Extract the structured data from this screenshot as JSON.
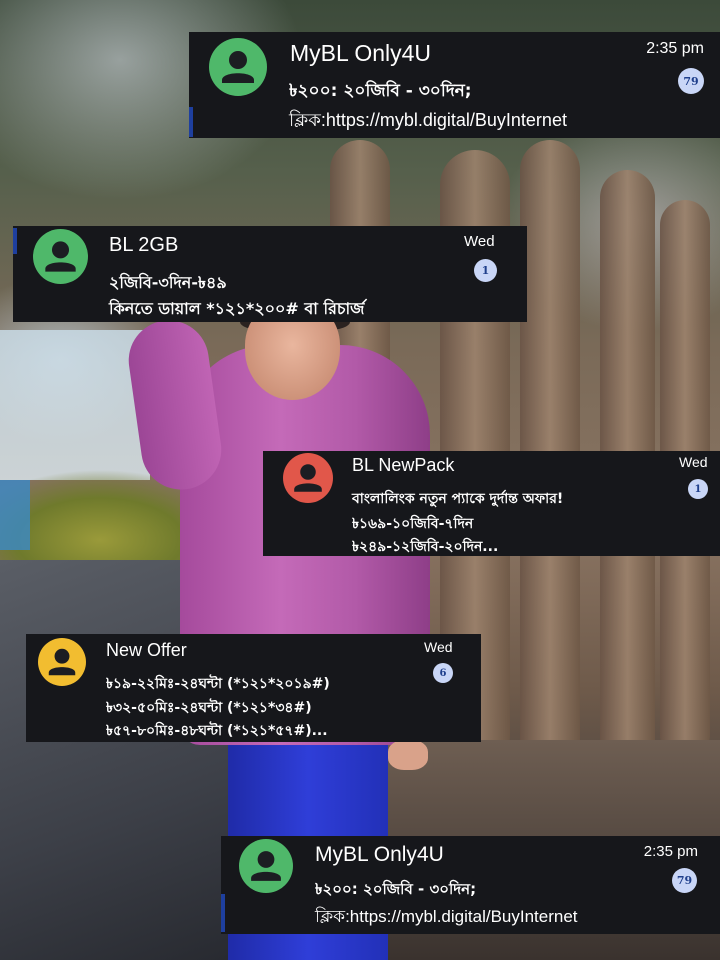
{
  "colors": {
    "card_bg": "#16171b",
    "text": "#ffffff",
    "badge_bg": "#c9d6f7",
    "badge_text": "#1f3f8c",
    "avatar_green": "#4fb86a",
    "avatar_red": "#e1574a",
    "avatar_yellow": "#f2bd30"
  },
  "notifications": [
    {
      "sender": "MyBL Only4U",
      "time": "2:35 pm",
      "lines": [
        "৳২০০: ২০জিবি - ৩০দিন;",
        "ক্লিক:https://mybl.digital/BuyInternet"
      ],
      "unread_count": "79",
      "avatar_icon": "person-icon",
      "avatar_color": "#4fb86a"
    },
    {
      "sender": "BL 2GB",
      "time": "Wed",
      "lines": [
        "২জিবি-৩দিন-৳৪৯",
        "কিনতে ডায়াল *১২১*২০০# বা রিচার্জ"
      ],
      "unread_count": "1",
      "avatar_icon": "person-icon",
      "avatar_color": "#4fb86a"
    },
    {
      "sender": "BL NewPack",
      "time": "Wed",
      "lines": [
        "বাংলালিংক নতুন প্যাকে দুর্দান্ত অফার!",
        "৳১৬৯-১০জিবি-৭দিন",
        "৳২৪৯-১২জিবি-২০দিন..."
      ],
      "unread_count": "1",
      "avatar_icon": "person-icon",
      "avatar_color": "#e1574a"
    },
    {
      "sender": "New Offer",
      "time": "Wed",
      "lines": [
        "৳১৯-২২মিঃ-২৪ঘন্টা (*১২১*২০১৯#)",
        "৳৩২-৫০মিঃ-২৪ঘন্টা (*১২১*৩৪#)",
        "৳৫৭-৮০মিঃ-৪৮ঘন্টা (*১২১*৫৭#)..."
      ],
      "unread_count": "6",
      "avatar_icon": "person-icon",
      "avatar_color": "#f2bd30"
    },
    {
      "sender": "MyBL Only4U",
      "time": "2:35 pm",
      "lines": [
        "৳২০০: ২০জিবি - ৩০দিন;",
        "ক্লিক:https://mybl.digital/BuyInternet"
      ],
      "unread_count": "79",
      "avatar_icon": "person-icon",
      "avatar_color": "#4fb86a"
    }
  ]
}
